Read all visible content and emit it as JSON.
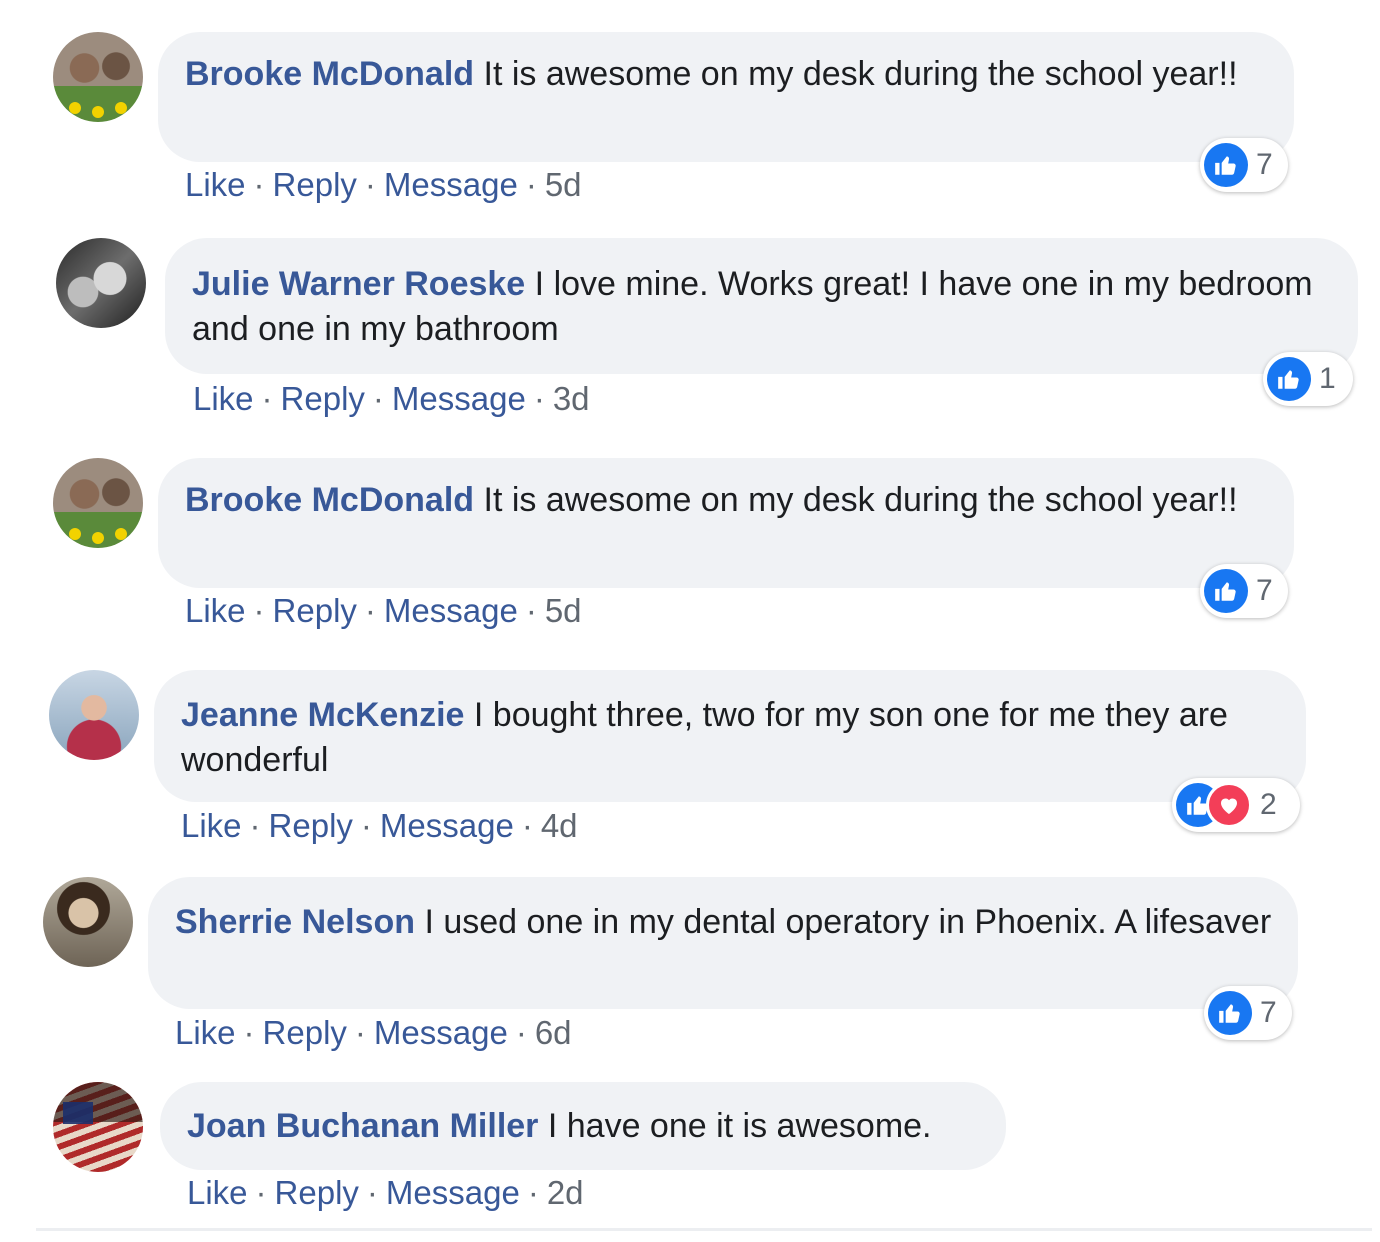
{
  "comments": [
    {
      "author": "Brooke McDonald",
      "text": "It is awesome on my desk during the school year!!",
      "actions": {
        "like": "Like",
        "reply": "Reply",
        "message": "Message",
        "time": "5d"
      },
      "reactions": {
        "types": [
          "like"
        ],
        "count": "7"
      }
    },
    {
      "author": "Julie Warner Roeske",
      "text": "I love mine. Works great! I have one in my bedroom and one in my bathroom",
      "actions": {
        "like": "Like",
        "reply": "Reply",
        "message": "Message",
        "time": "3d"
      },
      "reactions": {
        "types": [
          "like"
        ],
        "count": "1"
      }
    },
    {
      "author": "Brooke McDonald",
      "text": "It is awesome on my desk during the school year!!",
      "actions": {
        "like": "Like",
        "reply": "Reply",
        "message": "Message",
        "time": "5d"
      },
      "reactions": {
        "types": [
          "like"
        ],
        "count": "7"
      }
    },
    {
      "author": "Jeanne McKenzie",
      "text": "I bought three, two for my son one for me they are wonderful",
      "actions": {
        "like": "Like",
        "reply": "Reply",
        "message": "Message",
        "time": "4d"
      },
      "reactions": {
        "types": [
          "like",
          "love"
        ],
        "count": "2"
      }
    },
    {
      "author": "Sherrie Nelson",
      "text": "I used one in my dental operatory in Phoenix. A lifesaver",
      "actions": {
        "like": "Like",
        "reply": "Reply",
        "message": "Message",
        "time": "6d"
      },
      "reactions": {
        "types": [
          "like"
        ],
        "count": "7"
      }
    },
    {
      "author": "Joan Buchanan Miller",
      "text": "I have one it is awesome.",
      "actions": {
        "like": "Like",
        "reply": "Reply",
        "message": "Message",
        "time": "2d"
      },
      "reactions": null
    }
  ],
  "colors": {
    "link": "#385898",
    "bubble": "#f0f2f5",
    "meta": "#606770",
    "like": "#1877f2",
    "love": "#f33e58"
  },
  "icons": {
    "like": "thumbs-up-icon",
    "love": "heart-icon"
  }
}
